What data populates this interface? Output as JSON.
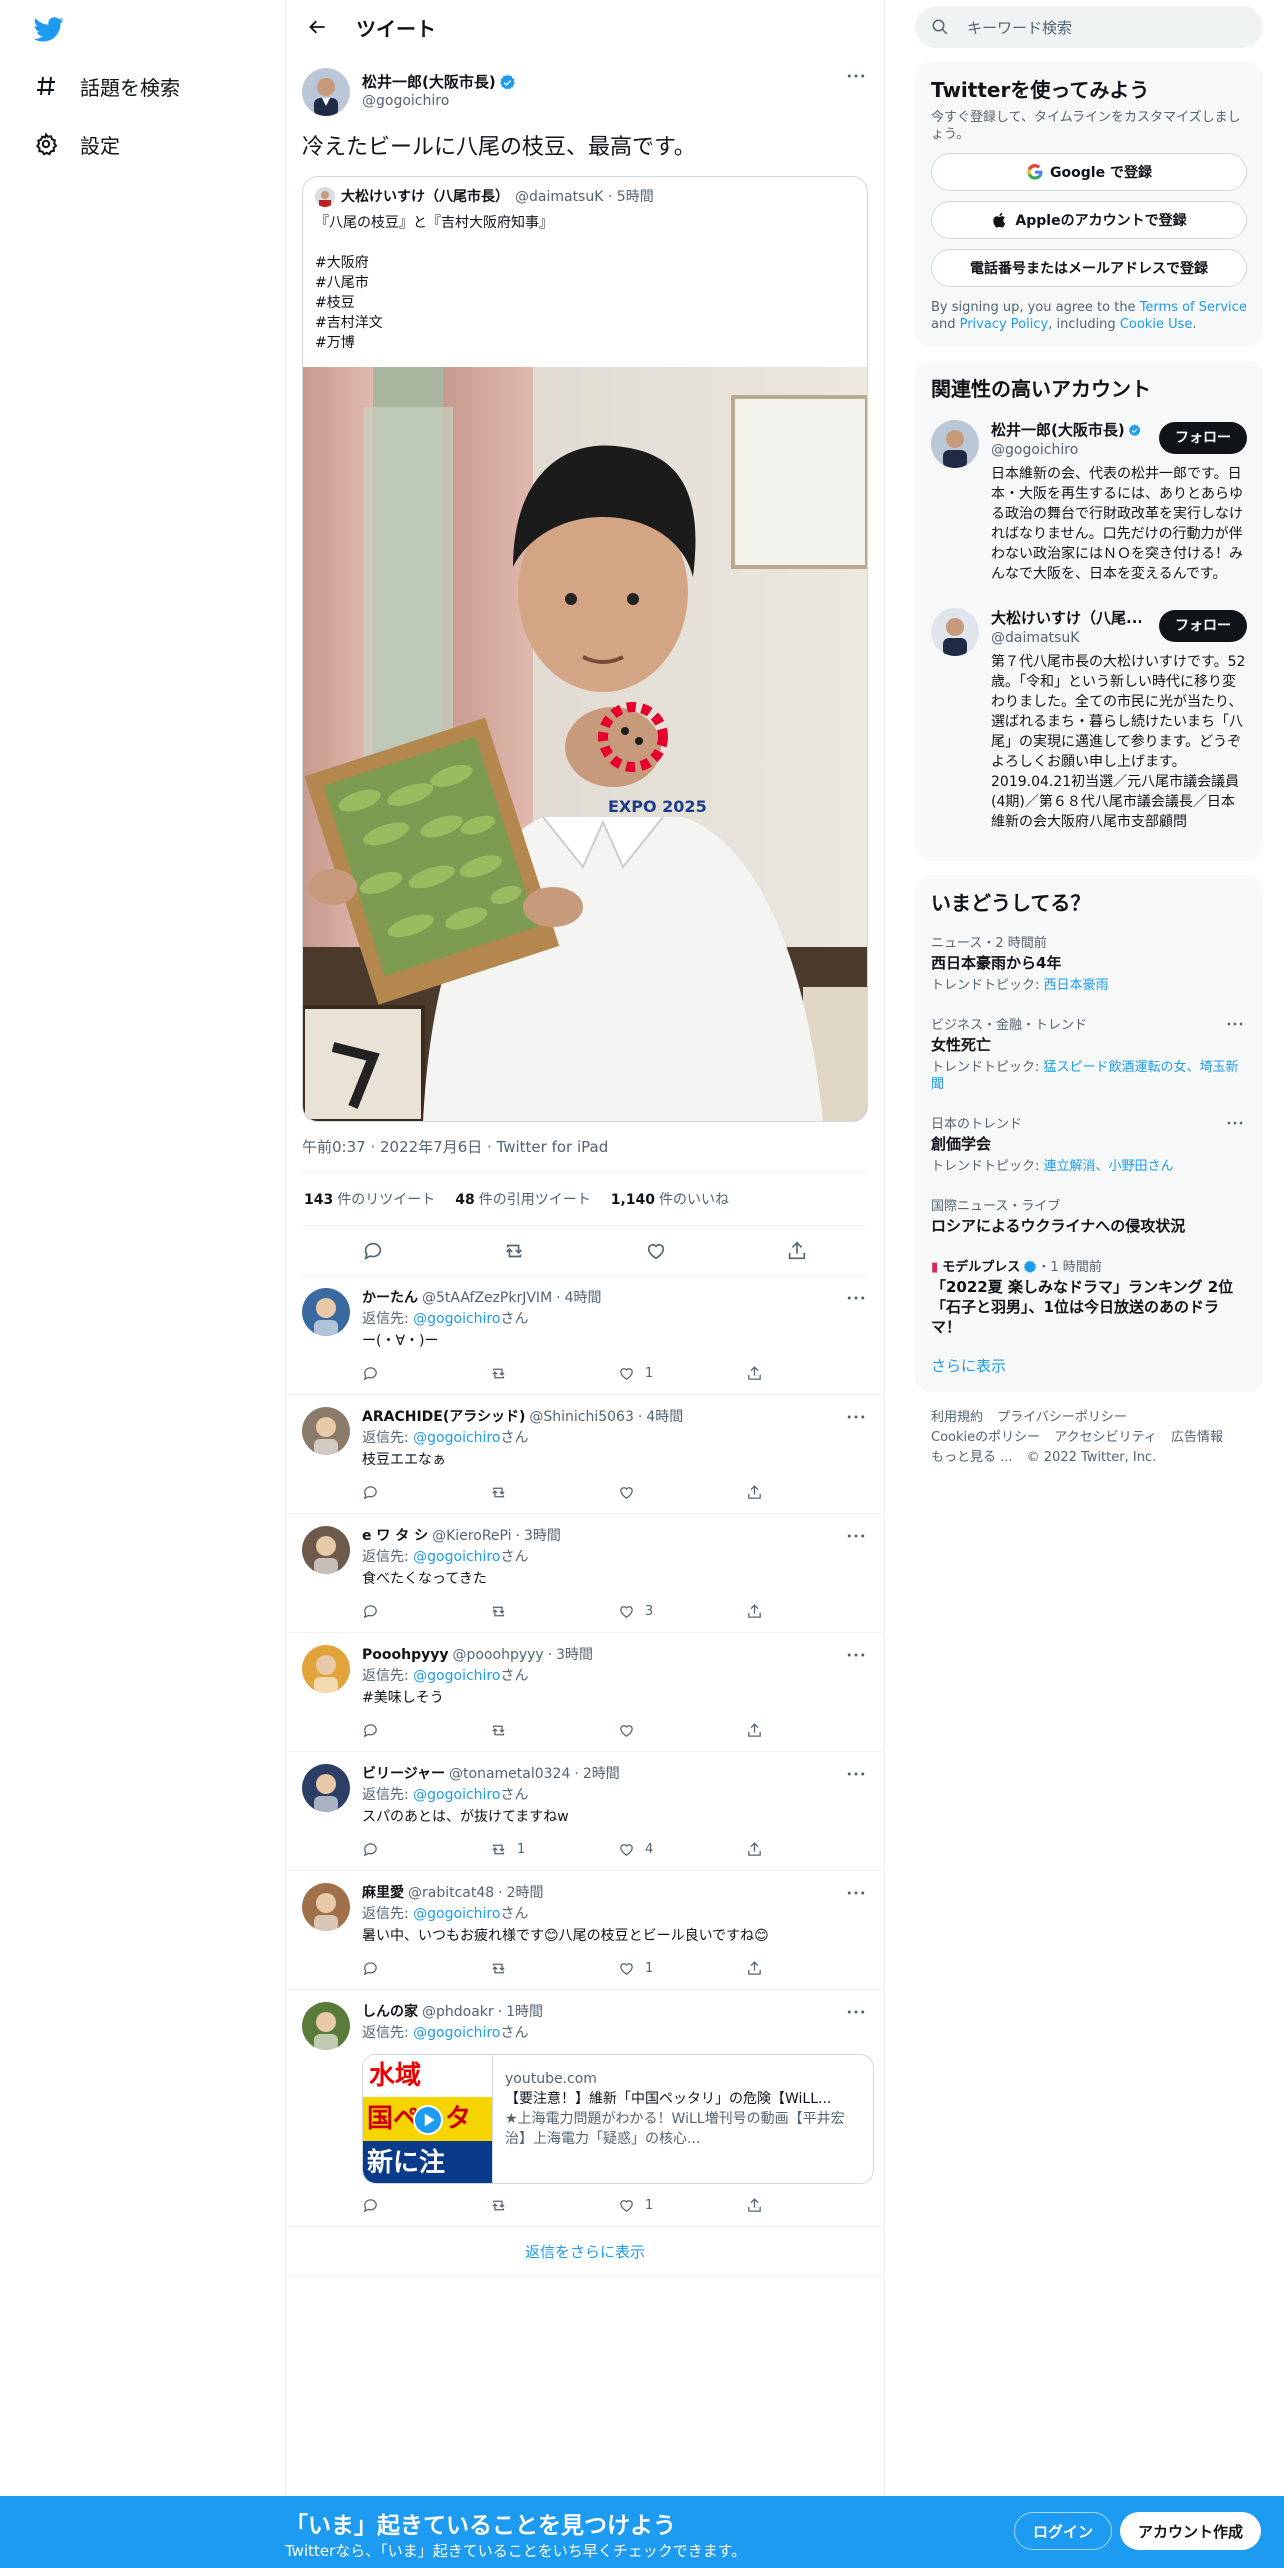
{
  "nav": {
    "explore": "話題を検索",
    "settings": "設定"
  },
  "header": {
    "title": "ツイート"
  },
  "tweet": {
    "name": "松井一郎(大阪市長)",
    "handle": "@gogoichiro",
    "text": "冷えたビールに八尾の枝豆、最高です。",
    "quote": {
      "name": "大松けいすけ（八尾市長）",
      "handle": "@daimatsuK",
      "time": "5時間",
      "body": "『八尾の枝豆』と『吉村大阪府知事』\n\n#大阪府\n#八尾市\n#枝豆\n#吉村洋文\n#万博",
      "expo_logo_text": "EXPO 2025"
    },
    "meta": "午前0:37 · 2022年7月6日 · Twitter for iPad",
    "stats": {
      "retweets": "143",
      "retweets_label": "件のリツイート",
      "quotes": "48",
      "quotes_label": "件の引用ツイート",
      "likes": "1,140",
      "likes_label": "件のいいね"
    }
  },
  "reply_to_label": "返信先:",
  "reply_to_handle": "@gogoichiro",
  "reply_to_suffix": "さん",
  "replies": [
    {
      "name": "かーたん",
      "handle": "@5tAAfZezPkrJVIM",
      "time": "4時間",
      "text": "ー(・∀・)ー",
      "retweets": "",
      "likes": "1"
    },
    {
      "name": "ARACHIDE(アラシッド)",
      "handle": "@Shinichi5063",
      "time": "4時間",
      "text": "枝豆エエなぁ",
      "retweets": "",
      "likes": ""
    },
    {
      "name": "e ワ タ シ",
      "handle": "@KieroRePi",
      "time": "3時間",
      "text": "食べたくなってきた",
      "retweets": "",
      "likes": "3"
    },
    {
      "name": "Pooohpyyy",
      "handle": "@pooohpyyy",
      "time": "3時間",
      "text": "#美味しそう",
      "retweets": "",
      "likes": ""
    },
    {
      "name": "ビリージャー",
      "handle": "@tonametal0324",
      "time": "2時間",
      "text": "スパのあとは、が抜けてますねw",
      "retweets": "1",
      "likes": "4"
    },
    {
      "name": "麻里愛",
      "handle": "@rabitcat48",
      "time": "2時間",
      "text": "暑い中、いつもお疲れ様です😊八尾の枝豆とビール良いですね😊",
      "retweets": "",
      "likes": "1"
    },
    {
      "name": "しんの家",
      "handle": "@phdoakr",
      "time": "1時間",
      "text": "",
      "retweets": "",
      "likes": "1"
    }
  ],
  "card": {
    "domain": "youtube.com",
    "title": "【要注意！】維新「中国ペッタリ」の危険【WiLL...",
    "desc": "★上海電力問題がわかる！WiLL増刊号の動画【平井宏治】上海電力「疑惑」の核心...",
    "thumb_line1": "水域",
    "thumb_line2": "国ペッタ",
    "thumb_line3": "新に注"
  },
  "show_more_replies": "返信をさらに表示",
  "sidebar": {
    "search_placeholder": "キーワード検索",
    "signup": {
      "title": "Twitterを使ってみよう",
      "sub": "今すぐ登録して、タイムラインをカスタマイズしましょう。",
      "google": "Google で登録",
      "apple": "Appleのアカウントで登録",
      "phone": "電話番号またはメールアドレスで登録",
      "terms_pre": "By signing up, you agree to the ",
      "terms_link": "Terms of Service",
      "terms_and": " and ",
      "privacy_link": "Privacy Policy",
      "terms_incl": ", including ",
      "cookie_link": "Cookie Use",
      "terms_end": "."
    },
    "related": {
      "title": "関連性の高いアカウント",
      "follow": "フォロー",
      "accounts": [
        {
          "name": "松井一郎(大阪市長)",
          "handle": "@gogoichiro",
          "bio": "日本維新の会、代表の松井一郎です。日本・大阪を再生するには、ありとあらゆる政治の舞台で行財政改革を実行しなければなりません。口先だけの行動力が伴わない政治家にはＮＯを突き付ける！みんなで大阪を、日本を変えるんです。"
        },
        {
          "name": "大松けいすけ（八尾...",
          "handle": "@daimatsuK",
          "bio": "第７代八尾市長の大松けいすけです。52歳。「令和」という新しい時代に移り変わりました。全ての市民に光が当たり、選ばれるまち・暮らし続けたいまち「八尾」の実現に邁進して参ります。どうぞよろしくお願い申し上げます。2019.04.21初当選／元八尾市議会議員(4期)／第６８代八尾市議会議長／日本維新の会大阪府八尾市支部顧問"
        }
      ]
    },
    "trends": {
      "title": "いまどうしてる？",
      "items": [
        {
          "ctx": "ニュース・2 時間前",
          "title": "西日本豪雨から4年",
          "sub_label": "トレンドトピック: ",
          "sub_link": "西日本豪雨"
        },
        {
          "ctx": "ビジネス・金融・トレンド",
          "title": "女性死亡",
          "sub_label": "トレンドトピック: ",
          "sub_link": "猛スピード飲酒運転の女、埼玉新聞"
        },
        {
          "ctx": "日本のトレンド",
          "title": "創価学会",
          "sub_label": "トレンドトピック: ",
          "sub_link": "連立解消、小野田さん"
        },
        {
          "ctx": "国際ニュース・ライブ",
          "title": "ロシアによるウクライナへの侵攻状況",
          "sub_label": "",
          "sub_link": ""
        },
        {
          "ctx_name": "モデルプレス",
          "ctx_time": "・1 時間前",
          "title": "「2022夏 楽しみなドラマ」ランキング 2位「石子と羽男」、1位は今日放送のあのドラマ！"
        }
      ],
      "show_more": "さらに表示"
    },
    "footer": {
      "terms": "利用規約",
      "privacy": "プライバシーポリシー",
      "cookie": "Cookieのポリシー",
      "access": "アクセシビリティ",
      "ads": "広告情報",
      "more": "もっと見る ...",
      "copy": "© 2022 Twitter, Inc."
    }
  },
  "bottombar": {
    "title": "「いま」起きていることを見つけよう",
    "sub": "Twitterなら、「いま」起きていることをいち早くチェックできます。",
    "login": "ログイン",
    "signup": "アカウント作成"
  },
  "colors": {
    "accent": "#1d9bf0",
    "text": "#0f1419",
    "secondary": "#536471"
  }
}
